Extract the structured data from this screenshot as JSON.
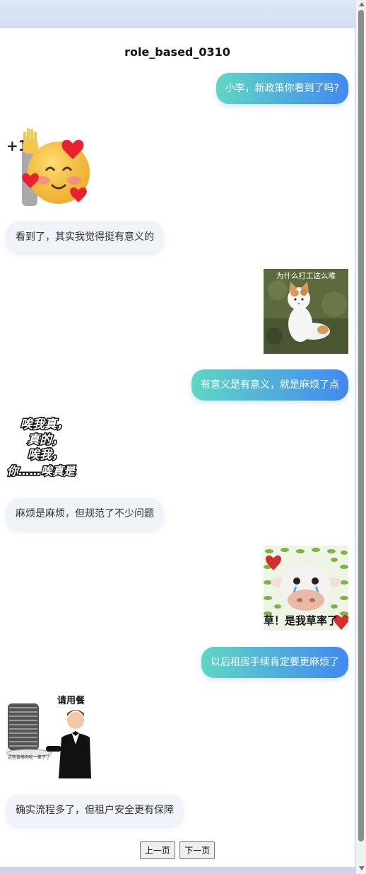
{
  "chat": {
    "title": "role_based_0310",
    "messages": [
      {
        "text": "小李，新政策你看到了吗?"
      },
      {
        "text": "看到了，其实我觉得挺有意义的"
      },
      {
        "text": "有意义是有意义，就是麻烦了点"
      },
      {
        "text": "麻烦是麻烦，但规范了不少问题"
      },
      {
        "text": "以后租房手续肯定要更麻烦了"
      },
      {
        "text": "确实流程多了，但租户安全更有保障"
      }
    ],
    "stickers": {
      "emoji": {
        "icon": "smiling-face-hand-raised",
        "caption": "+1"
      },
      "cat": {
        "caption": "为什么打工这么难"
      },
      "text_meme": {
        "lines": [
          "唉我真，",
          "真的，",
          "唉我，",
          "你……唉真是"
        ]
      },
      "cow": {
        "caption": "草！是我草率了"
      },
      "waiter": {
        "caption": "请用餐",
        "small_text": "这些苦够你吃一辈子了"
      }
    }
  },
  "pager": {
    "prev_label": "上一页",
    "next_label": "下一页"
  }
}
